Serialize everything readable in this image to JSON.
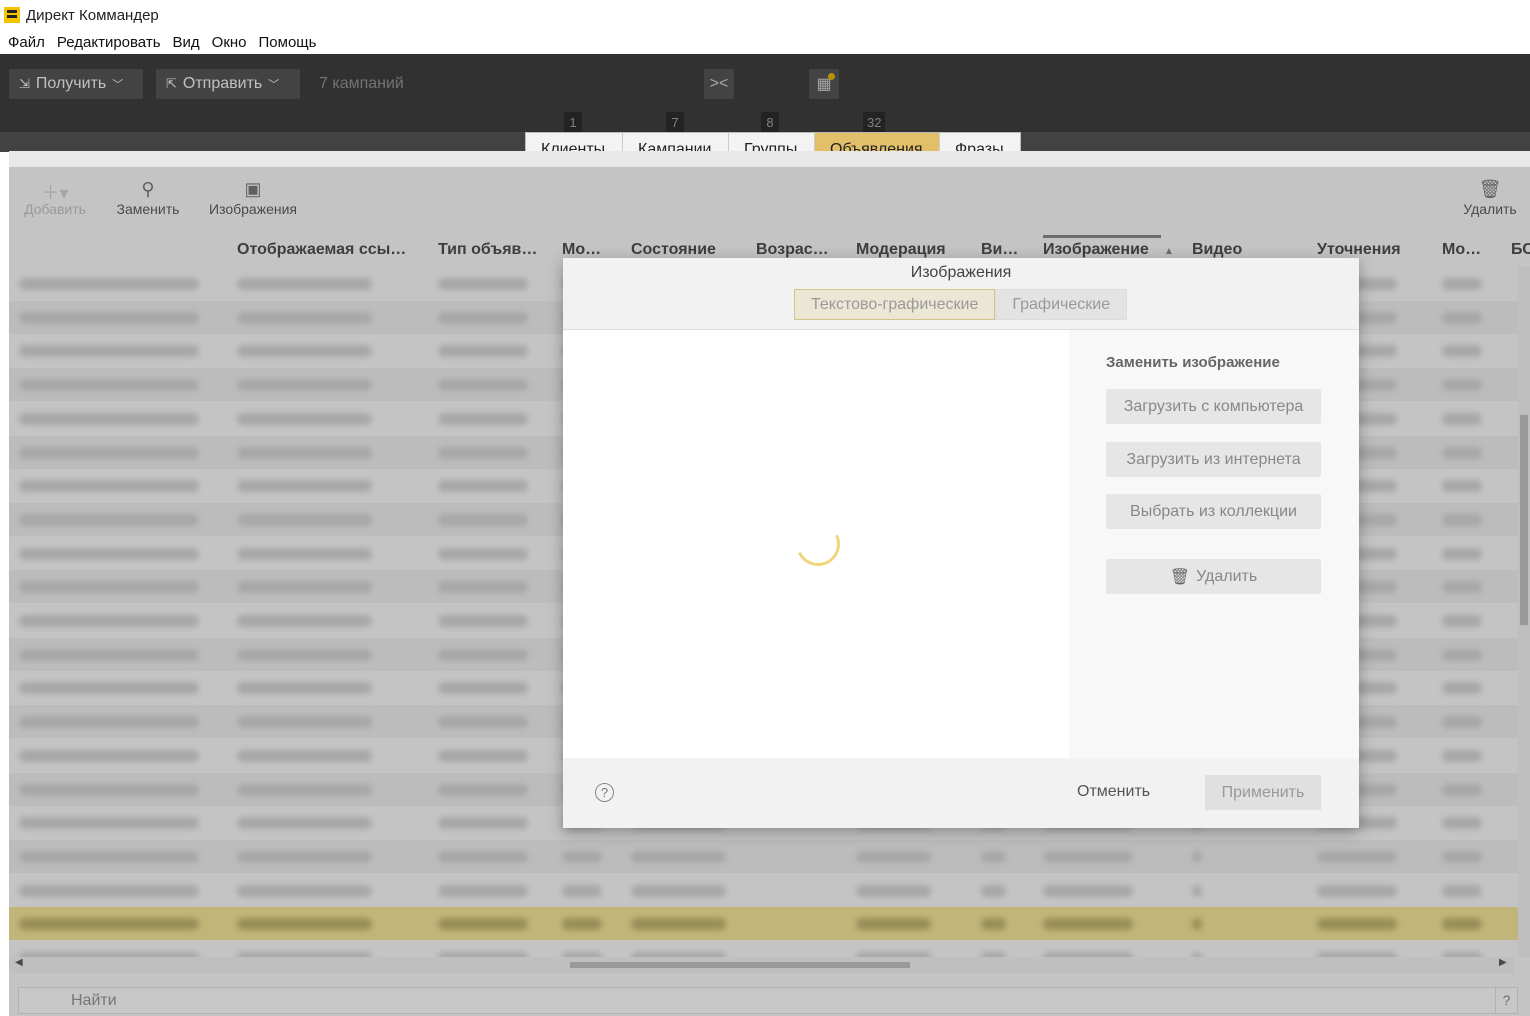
{
  "app": {
    "title": "Директ Коммандер"
  },
  "menu": [
    "Файл",
    "Редактировать",
    "Вид",
    "Окно",
    "Помощь"
  ],
  "topbar": {
    "get_label": "Получить",
    "send_label": "Отправить",
    "campaign_count": "7 кампаний"
  },
  "tabs": [
    {
      "label": "Клиенты",
      "count": "1"
    },
    {
      "label": "Кампании",
      "count": "7"
    },
    {
      "label": "Группы",
      "count": "8"
    },
    {
      "label": "Объявления",
      "count": "32",
      "active": true
    },
    {
      "label": "Фразы",
      "count": ""
    }
  ],
  "toolbar": {
    "add_label": "Добавить",
    "replace_label": "Заменить",
    "images_label": "Изображения",
    "delete_label": "Удалить"
  },
  "columns": [
    "Отображаемая ссы…",
    "Тип объяв…",
    "Мо…",
    "Состояние",
    "Возрас…",
    "Модерация",
    "Ви…",
    "Изображение",
    "Видео",
    "Уточнения",
    "Мо…",
    "БС"
  ],
  "search": {
    "placeholder": "Найти",
    "help": "?"
  },
  "modal": {
    "title": "Изображения",
    "tabs": [
      "Текстово-графические",
      "Графические"
    ],
    "active_tab": "Текстово-графические",
    "side_title": "Заменить изображение",
    "buttons": {
      "upload_computer": "Загрузить с компьютера",
      "upload_internet": "Загрузить из интернета",
      "choose_collection": "Выбрать из коллекции",
      "delete": "Удалить"
    },
    "cancel": "Отменить",
    "apply": "Применить",
    "help": "?"
  },
  "colors": {
    "accent": "#e2c06a",
    "topbar": "#424242",
    "selected_row": "#e4d27a",
    "spinner": "#f2d47c"
  }
}
